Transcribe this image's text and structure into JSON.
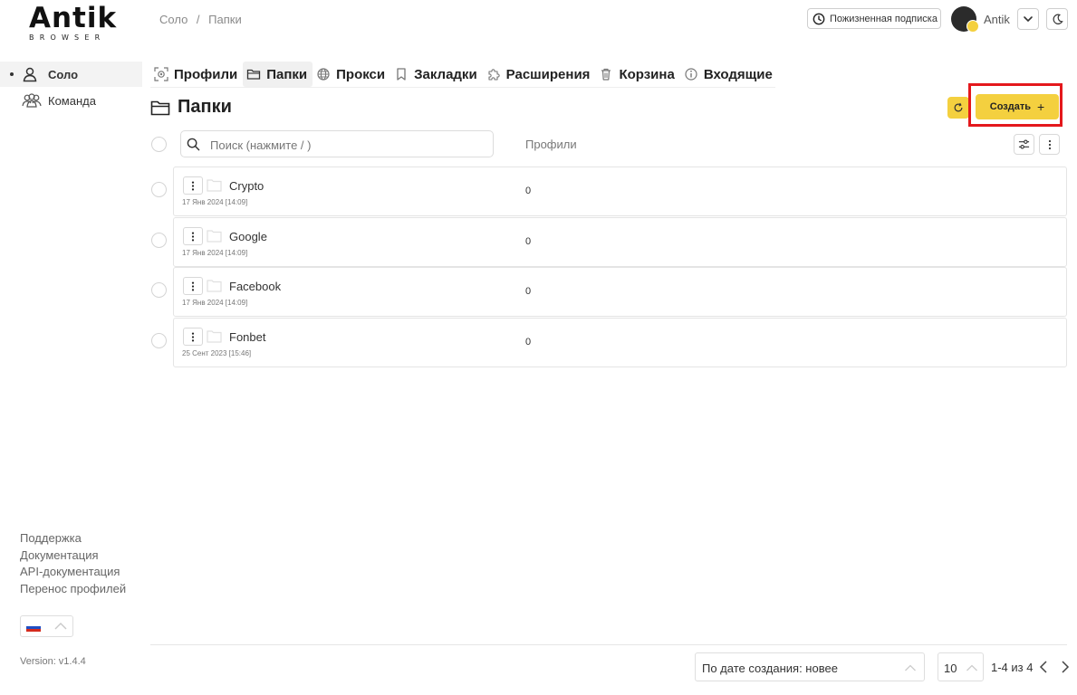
{
  "logo": {
    "main": "Antik",
    "sub": "BROWSER"
  },
  "breadcrumb": {
    "items": [
      "Соло",
      "/",
      "Папки"
    ]
  },
  "header": {
    "subscription_label": "Пожизненная подписка",
    "user_name": "Antik"
  },
  "sidebar": {
    "items": [
      {
        "label": "Соло",
        "icon": "user-icon",
        "active": true
      },
      {
        "label": "Команда",
        "icon": "team-icon",
        "active": false
      }
    ],
    "links": [
      "Поддержка",
      "Документация",
      "API-документация",
      "Перенос профилей"
    ],
    "language_flag": "ru-flag",
    "version": "Version: v1.4.4"
  },
  "tabs": [
    {
      "label": "Профили",
      "icon": "profiles-icon"
    },
    {
      "label": "Папки",
      "icon": "folder-icon",
      "active": true
    },
    {
      "label": "Прокси",
      "icon": "globe-icon"
    },
    {
      "label": "Закладки",
      "icon": "bookmark-icon"
    },
    {
      "label": "Расширения",
      "icon": "puzzle-icon"
    },
    {
      "label": "Корзина",
      "icon": "trash-icon"
    },
    {
      "label": "Входящие",
      "icon": "info-icon"
    }
  ],
  "page": {
    "title": "Папки",
    "create_label": "Создать"
  },
  "toolbar": {
    "search_placeholder": "Поиск (нажмите / )",
    "column_profiles": "Профили"
  },
  "folders": [
    {
      "name": "Crypto",
      "date": "17 Янв 2024 [14:09]",
      "profiles": "0"
    },
    {
      "name": "Google",
      "date": "17 Янв 2024 [14:09]",
      "profiles": "0"
    },
    {
      "name": "Facebook",
      "date": "17 Янв 2024 [14:09]",
      "profiles": "0"
    },
    {
      "name": "Fonbet",
      "date": "25 Сент 2023 [15:46]",
      "profiles": "0"
    }
  ],
  "footer": {
    "sort_value": "По дате создания: новее",
    "per_page": "10",
    "range": "1-4 из 4"
  },
  "colors": {
    "accent": "#f4d03f",
    "highlight": "#e4181c"
  }
}
